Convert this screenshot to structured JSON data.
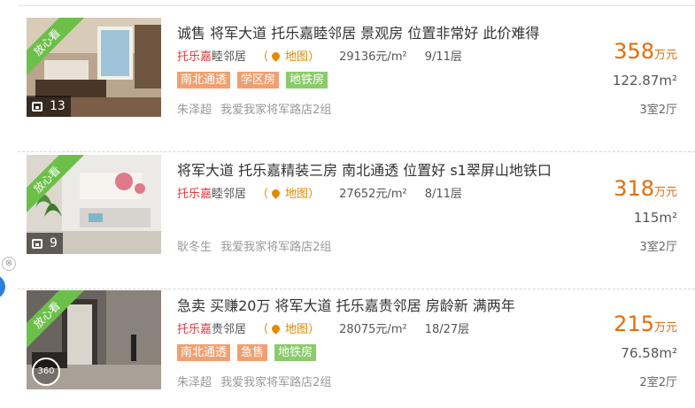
{
  "listings": [
    {
      "ribbon": "放心看",
      "photo_count": "13",
      "media_type": "gallery",
      "title": "诚售 将军大道 托乐嘉睦邻居 景观房 位置非常好 此价难得",
      "community_hl": "托乐嘉",
      "community_rest": "睦邻居",
      "map_label": "地图",
      "unit_price": "29136元/m²",
      "floor": "9/11层",
      "tags": [
        {
          "label": "南北通透",
          "color": "orange"
        },
        {
          "label": "学区房",
          "color": "orange"
        },
        {
          "label": "地铁房",
          "color": "green"
        }
      ],
      "agent_name": "朱泽超",
      "agent_store": "我爱我家将军路店2组",
      "total_price": "358",
      "price_unit": "万元",
      "area": "122.87m²",
      "layout": "3室2厅"
    },
    {
      "ribbon": "放心看",
      "photo_count": "9",
      "media_type": "gallery",
      "title": "将军大道 托乐嘉精装三房 南北通透 位置好 s1翠屏山地铁口",
      "community_hl": "托乐嘉",
      "community_rest": "睦邻居",
      "map_label": "地图",
      "unit_price": "27652元/m²",
      "floor": "8/11层",
      "tags": [],
      "agent_name": "耿冬生",
      "agent_store": "我爱我家将军路店2组",
      "total_price": "318",
      "price_unit": "万元",
      "area": "115m²",
      "layout": "3室2厅"
    },
    {
      "ribbon": "放心看",
      "photo_count": "360",
      "media_type": "vr",
      "title": "急卖 买赚20万 将军大道 托乐嘉贵邻居 房龄新 满两年",
      "community_hl": "托乐嘉",
      "community_rest": "贵邻居",
      "map_label": "地图",
      "unit_price": "28075元/m²",
      "floor": "18/27层",
      "tags": [
        {
          "label": "南北通透",
          "color": "orange"
        },
        {
          "label": "急售",
          "color": "orange"
        },
        {
          "label": "地铁房",
          "color": "green"
        }
      ],
      "agent_name": "朱泽超",
      "agent_store": "我爱我家将军路店2组",
      "total_price": "215",
      "price_unit": "万元",
      "area": "76.58m²",
      "layout": "2室2厅"
    }
  ],
  "colors": {
    "price": "#e36c0a",
    "highlight": "#e4393c",
    "tag_orange": "#f0a070",
    "tag_green": "#8bcb6b",
    "ribbon": "#6cc04a"
  },
  "side": {
    "close_glyph": "⊗"
  }
}
